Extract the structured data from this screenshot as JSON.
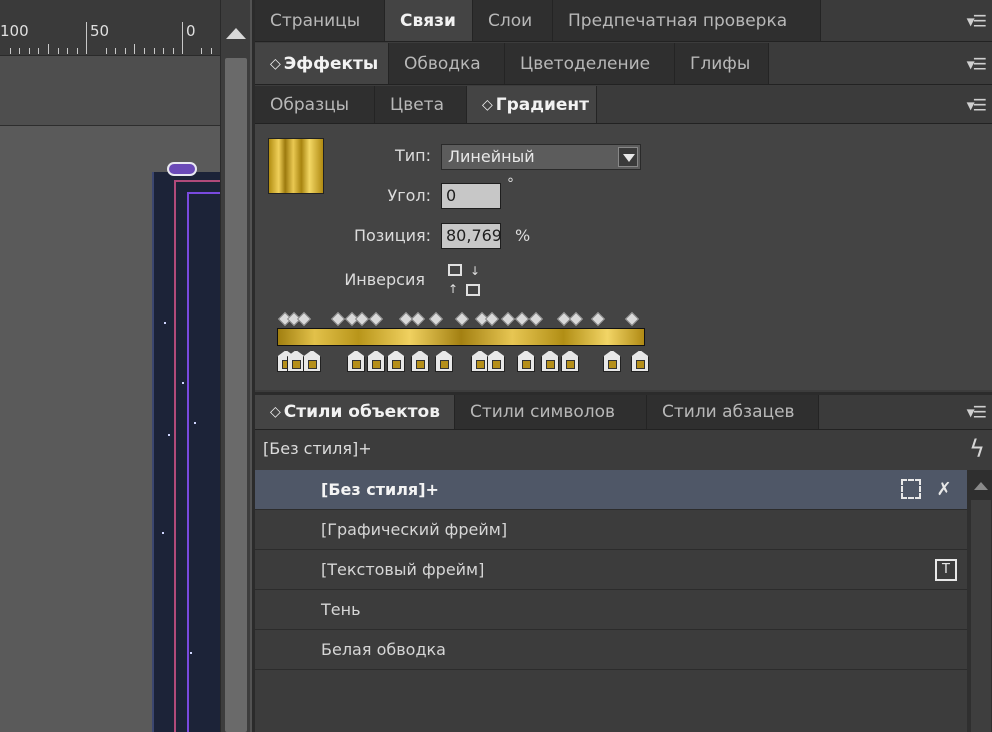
{
  "ruler": {
    "labels": [
      "100",
      "50",
      "0"
    ]
  },
  "panels": {
    "row1": {
      "tabs": [
        "Страницы",
        "Связи",
        "Слои",
        "Предпечатная проверка"
      ],
      "active": "Связи"
    },
    "row2": {
      "tabs": [
        "Эффекты",
        "Обводка",
        "Цветоделение",
        "Глифы"
      ],
      "active": "Эффекты"
    },
    "row3": {
      "tabs": [
        "Образцы",
        "Цвета",
        "Градиент"
      ],
      "active": "Градиент"
    }
  },
  "gradient": {
    "type_label": "Тип:",
    "type_value": "Линейный",
    "angle_label": "Угол:",
    "angle_value": "0",
    "degree_symbol": "°",
    "position_label": "Позиция:",
    "position_value": "80,769",
    "percent_symbol": "%",
    "reverse_label": "Инверсия",
    "swatch_color": "#d4b03a"
  },
  "object_styles": {
    "tabs": [
      "Стили объектов",
      "Стили символов",
      "Стили абзацев"
    ],
    "active": "Стили объектов",
    "current_style": "[Без стиля]+",
    "items": [
      {
        "label": "[Без стиля]+",
        "selected": true
      },
      {
        "label": "[Графический фрейм]",
        "selected": false
      },
      {
        "label": "[Текстовый фрейм]",
        "selected": false
      },
      {
        "label": "Тень",
        "selected": false
      },
      {
        "label": "Белая обводка",
        "selected": false
      }
    ]
  }
}
